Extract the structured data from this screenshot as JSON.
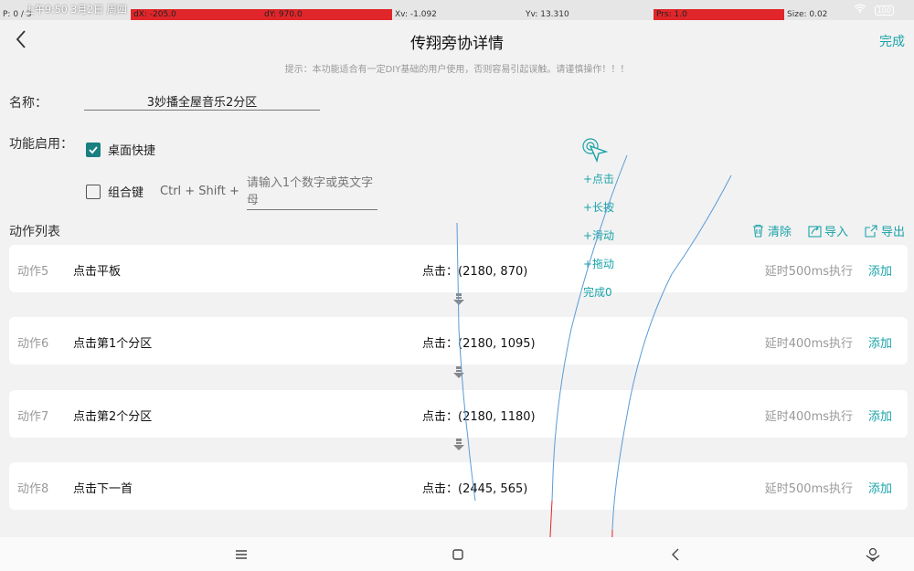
{
  "debug": {
    "p": "P: 0 / 3",
    "dx": "dX: -205.0",
    "dy": "dY: 970.0",
    "xv": "Xv: -1.092",
    "yv": "Yv: 13.310",
    "prs": "Prs: 1.0",
    "size": "Size: 0.02"
  },
  "status": {
    "time": "上午9:50 3月2日 周四",
    "battery": "100"
  },
  "header": {
    "title": "传翔旁协详情",
    "done_label": "完成"
  },
  "hint": "提示：本功能适合有一定DIY基础的用户使用，否则容易引起误触。请谨慎操作！！！",
  "form": {
    "name_label": "名称：",
    "name_value": "3妙播全屋音乐2分区",
    "enable_label": "功能启用：",
    "desktop_shortcut_label": "桌面快捷",
    "desktop_shortcut_checked": true,
    "combo_key_label": "组合键",
    "combo_key_checked": false,
    "combo_prefix": "Ctrl + Shift +",
    "combo_placeholder": "请输入1个数字或英文字母"
  },
  "actions_section": {
    "title": "动作列表",
    "clear_label": "清除",
    "import_label": "导入",
    "export_label": "导出"
  },
  "actions": [
    {
      "index": "动作5",
      "desc": "点击平板",
      "coord": "点击：(2180, 870)",
      "delay": "延时500ms执行",
      "add": "添加"
    },
    {
      "index": "动作6",
      "desc": "点击第1个分区",
      "coord": "点击：(2180, 1095)",
      "delay": "延时400ms执行",
      "add": "添加"
    },
    {
      "index": "动作7",
      "desc": "点击第2个分区",
      "coord": "点击：(2180, 1180)",
      "delay": "延时400ms执行",
      "add": "添加"
    },
    {
      "index": "动作8",
      "desc": "点击下一首",
      "coord": "点击：(2445, 565)",
      "delay": "延时500ms执行",
      "add": "添加"
    }
  ],
  "float_panel": {
    "click": "+点击",
    "long_press": "+长按",
    "swipe": "+滑动",
    "drag": "+拖动",
    "done": "完成0"
  },
  "colors": {
    "accent": "#1aa3a8",
    "check": "#1a7f80",
    "debug_red": "#e0262a"
  },
  "icons": [
    "back-arrow-icon",
    "trash-icon",
    "import-icon",
    "export-icon",
    "down-arrow-icon",
    "cursor-tap-icon",
    "menu-icon",
    "home-icon",
    "nav-back-icon",
    "assistant-icon"
  ]
}
